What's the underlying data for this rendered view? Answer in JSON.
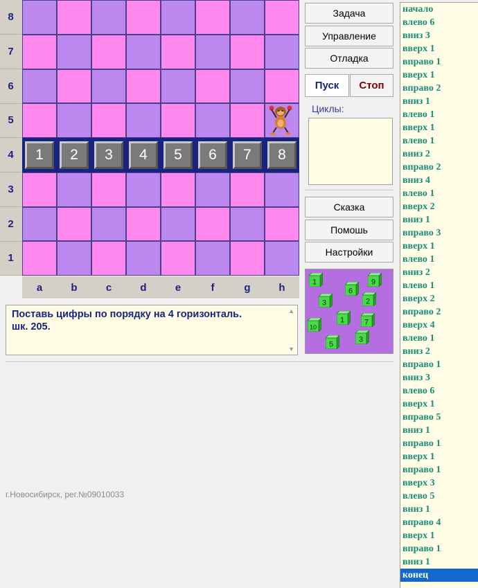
{
  "board": {
    "ranks": [
      "8",
      "7",
      "6",
      "5",
      "4",
      "3",
      "2",
      "1"
    ],
    "files": [
      "a",
      "b",
      "c",
      "d",
      "e",
      "f",
      "g",
      "h"
    ],
    "tiles": [
      "1",
      "2",
      "3",
      "4",
      "5",
      "6",
      "7",
      "8"
    ],
    "colors": {
      "pink": "#fe88ee",
      "lavender": "#bc88f0",
      "frame": "#1a237e"
    }
  },
  "message": {
    "line1": "Поставь цифры по порядку на 4 горизонталь.",
    "line2": "шк. 205."
  },
  "footer": "г.Новосибирск, рег.№09010033",
  "buttons": {
    "task": "Задача",
    "control": "Управление",
    "debug": "Отладка",
    "run": "Пуск",
    "stop": "Стоп",
    "tale": "Сказка",
    "help": "Помошь",
    "settings": "Настройки"
  },
  "loops_label": "Циклы:",
  "picture_cubes": [
    "1",
    "6",
    "9",
    "3",
    "2",
    "10",
    "1",
    "7",
    "5",
    "3"
  ],
  "program": [
    "начало",
    "влево 6",
    "вниз 3",
    "вверх 1",
    "вправо 1",
    "вверх 1",
    "вправо 2",
    "вниз 1",
    "влево 1",
    "вверх 1",
    "влево 1",
    "вниз 2",
    "вправо 2",
    "вниз 4",
    "влево 1",
    "вверх 2",
    "вниз 1",
    "вправо 3",
    "вверх 1",
    "влево 1",
    "вниз 2",
    "влево 1",
    "вверх 2",
    "вправо 2",
    "вверх 4",
    "влево 1",
    "вниз 2",
    "вправо 1",
    "вниз 3",
    "влево 6",
    "вверх 1",
    "вправо 5",
    "вниз 1",
    "вправо 1",
    "вверх 1",
    "вправо 1",
    "вверх 3",
    "влево 5",
    "вниз 1",
    "вправо 4",
    "вверх 1",
    "вправо 1",
    "вниз 1",
    "конец"
  ],
  "program_selected": "конец"
}
